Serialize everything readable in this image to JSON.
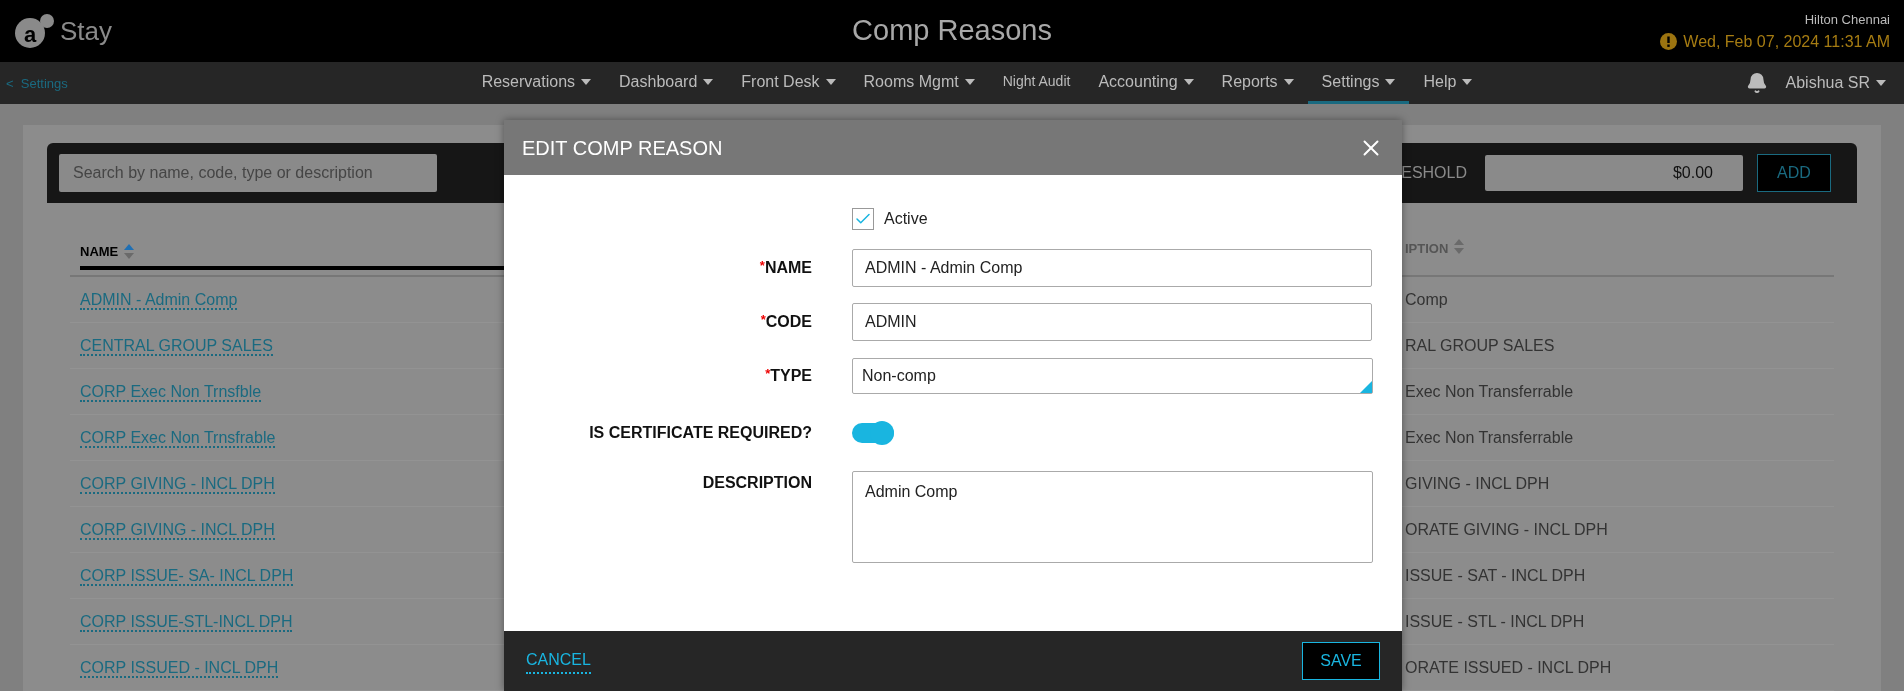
{
  "header": {
    "logo": {
      "mark": "a",
      "name": "Stay"
    },
    "title": "Comp Reasons",
    "property": "Hilton Chennai",
    "datetime": "Wed, Feb 07, 2024 11:31 AM",
    "alert": true
  },
  "nav": {
    "back": "<",
    "back_label": "Settings",
    "items": [
      {
        "label": "Reservations",
        "dropdown": true,
        "selected": false
      },
      {
        "label": "Dashboard",
        "dropdown": true,
        "selected": false
      },
      {
        "label": "Front Desk",
        "dropdown": true,
        "selected": false
      },
      {
        "label": "Rooms Mgmt",
        "dropdown": true,
        "selected": false
      },
      {
        "label": "Night Audit",
        "dropdown": false,
        "selected": false
      },
      {
        "label": "Accounting",
        "dropdown": true,
        "selected": false
      },
      {
        "label": "Reports",
        "dropdown": true,
        "selected": false
      },
      {
        "label": "Settings",
        "dropdown": true,
        "selected": true
      },
      {
        "label": "Help",
        "dropdown": true,
        "selected": false
      }
    ],
    "user": "Abishua SR"
  },
  "toolbar": {
    "search": {
      "placeholder": "Search by name, code, type or description"
    },
    "threshold_label": "ESHOLD",
    "threshold_value": "$0.00",
    "add": "ADD"
  },
  "table": {
    "columns": [
      {
        "label": "NAME",
        "sorted": true
      },
      {
        "label": "IPTION",
        "sorted": false
      }
    ],
    "rows": [
      {
        "name": "ADMIN - Admin Comp",
        "description": "Comp"
      },
      {
        "name": "CENTRAL GROUP SALES",
        "description": "RAL GROUP SALES"
      },
      {
        "name": "CORP Exec Non Trnsfble",
        "description": "Exec Non Transferrable"
      },
      {
        "name": "CORP Exec Non Trnsfrable",
        "description": "Exec Non Transferrable"
      },
      {
        "name": "CORP GIVING - INCL DPH",
        "description": "GIVING - INCL DPH"
      },
      {
        "name": "CORP GIVING - INCL DPH",
        "description": "ORATE GIVING - INCL DPH"
      },
      {
        "name": "CORP ISSUE- SA- INCL DPH",
        "description": "ISSUE - SAT - INCL DPH"
      },
      {
        "name": "CORP ISSUE-STL-INCL DPH",
        "description": "ISSUE - STL - INCL DPH"
      },
      {
        "name": "CORP ISSUED - INCL DPH",
        "description": "ORATE ISSUED - INCL DPH"
      }
    ]
  },
  "dialog": {
    "title": "EDIT COMP REASON",
    "required_mark": "*",
    "active": {
      "label": "Active",
      "checked": true
    },
    "fields": [
      {
        "kind": "text",
        "label": "NAME",
        "required": true,
        "value": "ADMIN - Admin Comp"
      },
      {
        "kind": "text",
        "label": "CODE",
        "required": true,
        "value": "ADMIN"
      },
      {
        "kind": "select",
        "label": "TYPE",
        "required": true,
        "value": "Non-comp"
      },
      {
        "kind": "toggle",
        "label": "IS CERTIFICATE REQUIRED?",
        "required": false,
        "on": true
      },
      {
        "kind": "textarea",
        "label": "DESCRIPTION",
        "required": false,
        "value": "Admin Comp"
      }
    ],
    "cancel": "CANCEL",
    "save": "SAVE"
  }
}
